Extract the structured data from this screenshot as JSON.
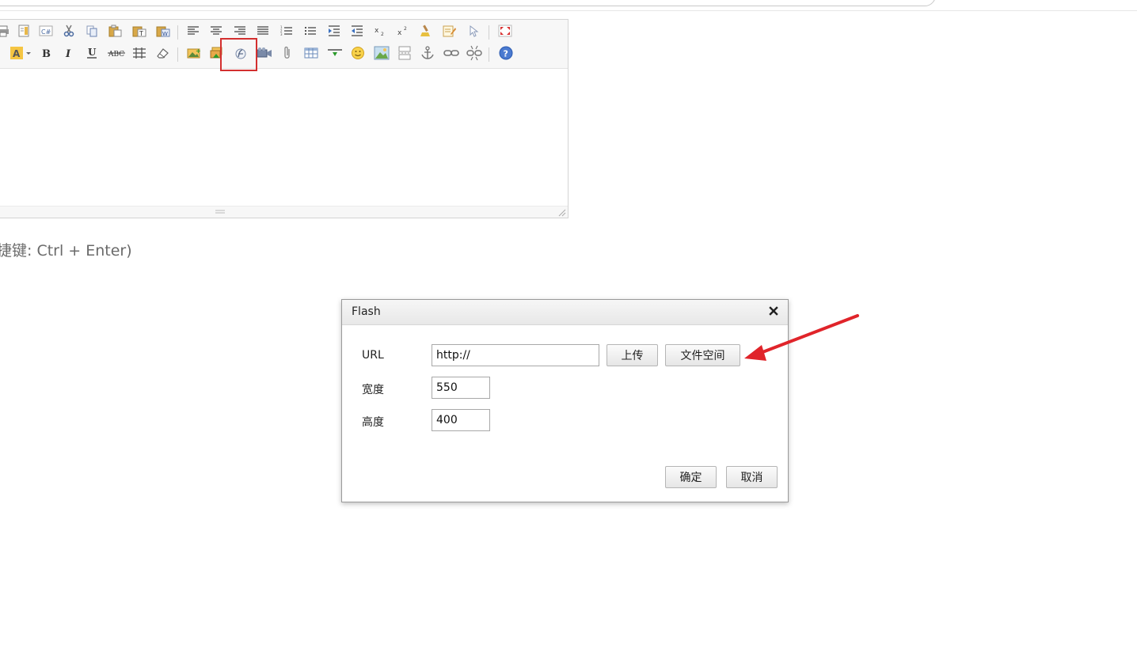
{
  "hint": {
    "text": "捷键: Ctrl + Enter)"
  },
  "toolbar": {
    "row1_icons": [
      "print-icon",
      "template-icon",
      "code-icon",
      "cut-icon",
      "copy-icon",
      "paste-icon",
      "paste-text-icon",
      "paste-word-icon",
      "align-left-icon",
      "align-center-icon",
      "align-right-icon",
      "align-justify-icon",
      "ordered-list-icon",
      "unordered-list-icon",
      "indent-icon",
      "outdent-icon",
      "subscript-icon",
      "superscript-icon",
      "clear-format-icon",
      "select-all-icon",
      "quick-format-icon",
      "fullscreen-icon"
    ],
    "row2_icons": [
      "font-color-icon",
      "bold-icon",
      "italic-icon",
      "underline-icon",
      "strikethrough-icon",
      "line-height-icon",
      "remove-format-icon",
      "image-icon",
      "multi-image-icon",
      "flash-icon",
      "media-icon",
      "insert-file-icon",
      "table-icon",
      "horizontal-rule-icon",
      "emoticon-icon",
      "baidu-map-icon",
      "page-break-icon",
      "anchor-icon",
      "link-icon",
      "unlink-icon",
      "help-icon"
    ]
  },
  "dialog": {
    "title": "Flash",
    "url_label": "URL",
    "url_value": "http://",
    "upload_button": "上传",
    "file_space_button": "文件空间",
    "width_label": "宽度",
    "width_value": "550",
    "height_label": "高度",
    "height_value": "400",
    "ok_button": "确定",
    "cancel_button": "取消"
  },
  "colors": {
    "highlight": "#d32f2f",
    "arrow": "#e0242a",
    "toolbar_bg": "#f7f7f7"
  }
}
